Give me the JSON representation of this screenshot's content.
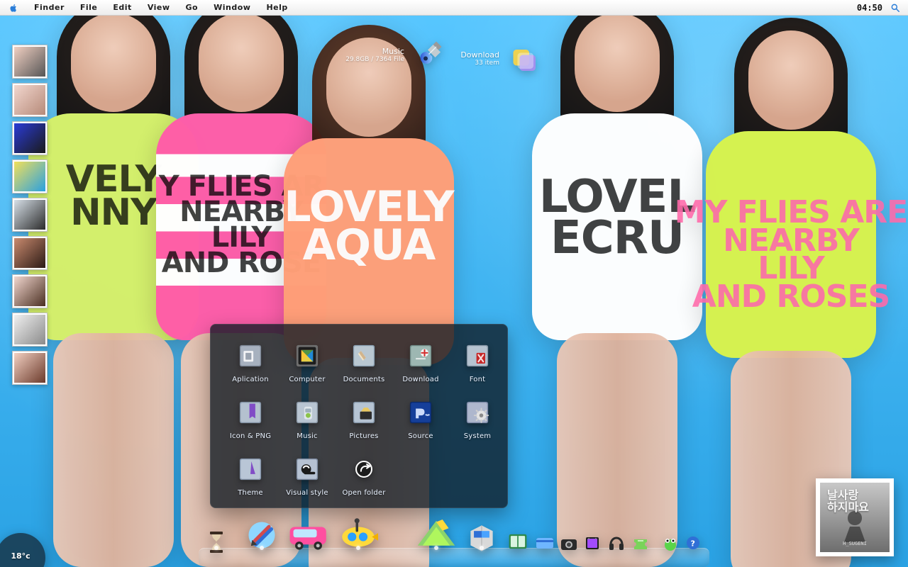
{
  "menubar": {
    "items": [
      "Finder",
      "File",
      "Edit",
      "View",
      "Go",
      "Window",
      "Help"
    ],
    "time": "04:50"
  },
  "widgets": {
    "music": {
      "title": "Music",
      "sub": "29.8GB / 7364 File"
    },
    "download": {
      "title": "Download",
      "sub": "33  item"
    }
  },
  "panel": {
    "tiles": [
      {
        "label": "Aplication"
      },
      {
        "label": "Computer"
      },
      {
        "label": "Documents"
      },
      {
        "label": "Download"
      },
      {
        "label": "Font"
      },
      {
        "label": "Icon & PNG"
      },
      {
        "label": "Music"
      },
      {
        "label": "Pictures"
      },
      {
        "label": "Source"
      },
      {
        "label": "System"
      },
      {
        "label": "Theme"
      },
      {
        "label": "Visual style"
      },
      {
        "label": "Open folder"
      }
    ]
  },
  "wallpaper": {
    "shirt_texts": [
      "VELY\nNNY",
      "Y FLIES AR\nNEARBY\nLILY\nAND ROSE",
      "LOVELY\nAQUA",
      "LOVEL\nECRU",
      "MY FLIES ARE\nNEARBY\nLILY\nAND ROSES"
    ]
  },
  "temperature": "18°c",
  "album": {
    "art_text": "날사랑\n하지마요",
    "small": "H_SUGENI"
  },
  "colors": {
    "accent": "#2a7dd8"
  },
  "icons": {
    "apple": "apple-icon",
    "search": "search-icon"
  }
}
